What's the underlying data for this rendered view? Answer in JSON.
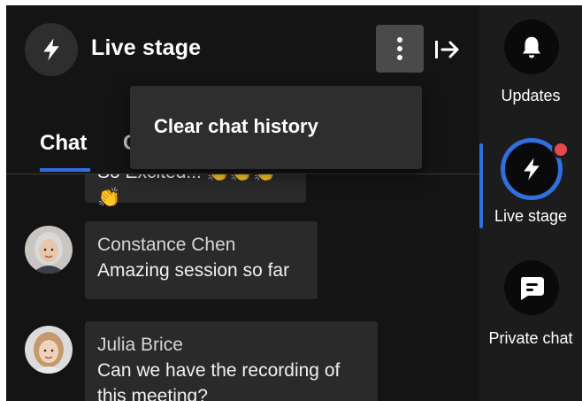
{
  "header": {
    "title": "Live stage",
    "stage_icon": "bolt-icon",
    "more_icon": "kebab-vertical-icon",
    "exit_icon": "exit-arrow-icon"
  },
  "tabs": [
    {
      "label": "Chat",
      "active": true
    },
    {
      "label": "C",
      "active": false
    }
  ],
  "menu": {
    "items": [
      {
        "label": "Clear chat history"
      }
    ]
  },
  "messages": [
    {
      "sender": "",
      "text": "So Excited!!! 👏👏👏👏"
    },
    {
      "sender": "Constance Chen",
      "text": "Amazing session so far"
    },
    {
      "sender": "Julia Brice",
      "text": "Can we have the recording of this meeting?"
    }
  ],
  "rail": {
    "items": [
      {
        "label": "Updates",
        "icon": "bell-icon"
      },
      {
        "label": "Live stage",
        "icon": "bolt-icon",
        "active": true,
        "has_notification": true
      },
      {
        "label": "Private chat",
        "icon": "chat-bubble-icon"
      }
    ]
  },
  "colors": {
    "background": "#141414",
    "accent": "#2f6fde",
    "notification": "#e5484d",
    "bubble": "#2a2a2a"
  }
}
